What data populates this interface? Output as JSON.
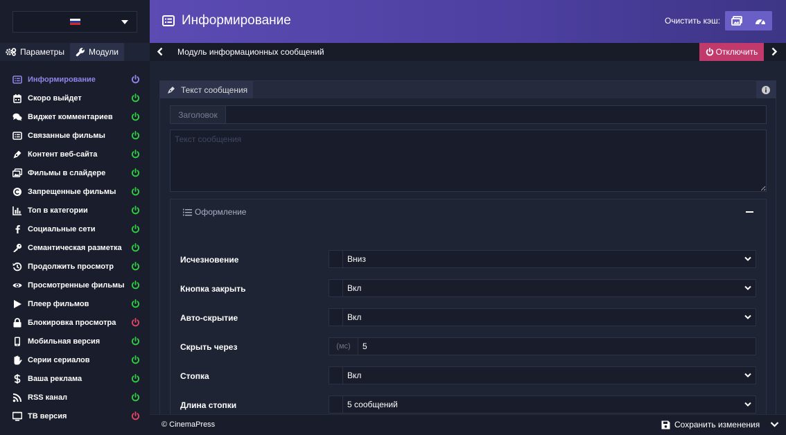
{
  "header": {
    "title": "Информирование",
    "cache_label": "Очистить кэш:",
    "cache_buttons": [
      {
        "icon": "image-icon"
      },
      {
        "icon": "dashboard-icon"
      }
    ],
    "gradient_colors": [
      "#5b4bb3",
      "#3d3585"
    ]
  },
  "lang": {
    "selected": "ru",
    "flag_colors": [
      "#ffffff",
      "#1c3faa",
      "#d52b1e"
    ]
  },
  "sidebar": {
    "tabs": [
      {
        "label": "Параметры",
        "icon": "cogs-icon"
      },
      {
        "label": "Модули",
        "icon": "wrench-icon"
      }
    ],
    "items": [
      {
        "label": "Информирование",
        "icon": "list-alt-icon",
        "power": "active"
      },
      {
        "label": "Скоро выйдет",
        "icon": "calendar-icon",
        "power": "on"
      },
      {
        "label": "Виджет комментариев",
        "icon": "comments-icon",
        "power": "on"
      },
      {
        "label": "Связанные фильмы",
        "icon": "list-alt-icon",
        "power": "on"
      },
      {
        "label": "Контент веб-сайта",
        "icon": "pen-nib-icon",
        "power": "on"
      },
      {
        "label": "Фильмы в слайдере",
        "icon": "images-icon",
        "power": "on"
      },
      {
        "label": "Запрещенные фильмы",
        "icon": "copyright-icon",
        "power": "on"
      },
      {
        "label": "Топ в категории",
        "icon": "chart-bar-icon",
        "power": "on"
      },
      {
        "label": "Социальные сети",
        "icon": "facebook-icon",
        "power": "on"
      },
      {
        "label": "Семантическая разметка",
        "icon": "key-icon",
        "power": "on"
      },
      {
        "label": "Продолжить просмотр",
        "icon": "history-icon",
        "power": "on"
      },
      {
        "label": "Просмотренные фильмы",
        "icon": "eye-icon",
        "power": "on"
      },
      {
        "label": "Плеер фильмов",
        "icon": "play-icon",
        "power": "on"
      },
      {
        "label": "Блокировка просмотра",
        "icon": "lock-icon",
        "power": "off"
      },
      {
        "label": "Мобильная версия",
        "icon": "mobile-icon",
        "power": "on"
      },
      {
        "label": "Серии сериалов",
        "icon": "hand-icon",
        "power": "on"
      },
      {
        "label": "Ваша реклама",
        "icon": "dollar-icon",
        "power": "on"
      },
      {
        "label": "RSS канал",
        "icon": "rss-icon",
        "power": "on"
      },
      {
        "label": "ТВ версия",
        "icon": "tv-icon",
        "power": "off"
      }
    ],
    "power_colors": {
      "active": "#8d86e8",
      "on": "#2ecc40",
      "off": "#e04560"
    }
  },
  "subbar": {
    "module_title": "Модуль информационных сообщений",
    "disable_label": "Отключить",
    "disable_color": "#c23a6c"
  },
  "panel": {
    "tab_label": "Текст сообщения",
    "title_addon": "Заголовок",
    "title_value": "",
    "text_placeholder": "Текст сообщения",
    "design": {
      "title": "Оформление",
      "rows": [
        {
          "label": "Исчезновение",
          "type": "select",
          "value": "Вниз"
        },
        {
          "label": "Кнопка закрыть",
          "type": "select",
          "value": "Вкл"
        },
        {
          "label": "Авто-скрытие",
          "type": "select",
          "value": "Вкл"
        },
        {
          "label": "Скрыть через",
          "type": "input",
          "addon": "(мс)",
          "value": "5"
        },
        {
          "label": "Стопка",
          "type": "select",
          "value": "Вкл"
        },
        {
          "label": "Длина стопки",
          "type": "select",
          "value": "5 сообщений"
        }
      ]
    }
  },
  "footer": {
    "copyright": "© CinemaPress",
    "save_label": "Сохранить изменения"
  }
}
